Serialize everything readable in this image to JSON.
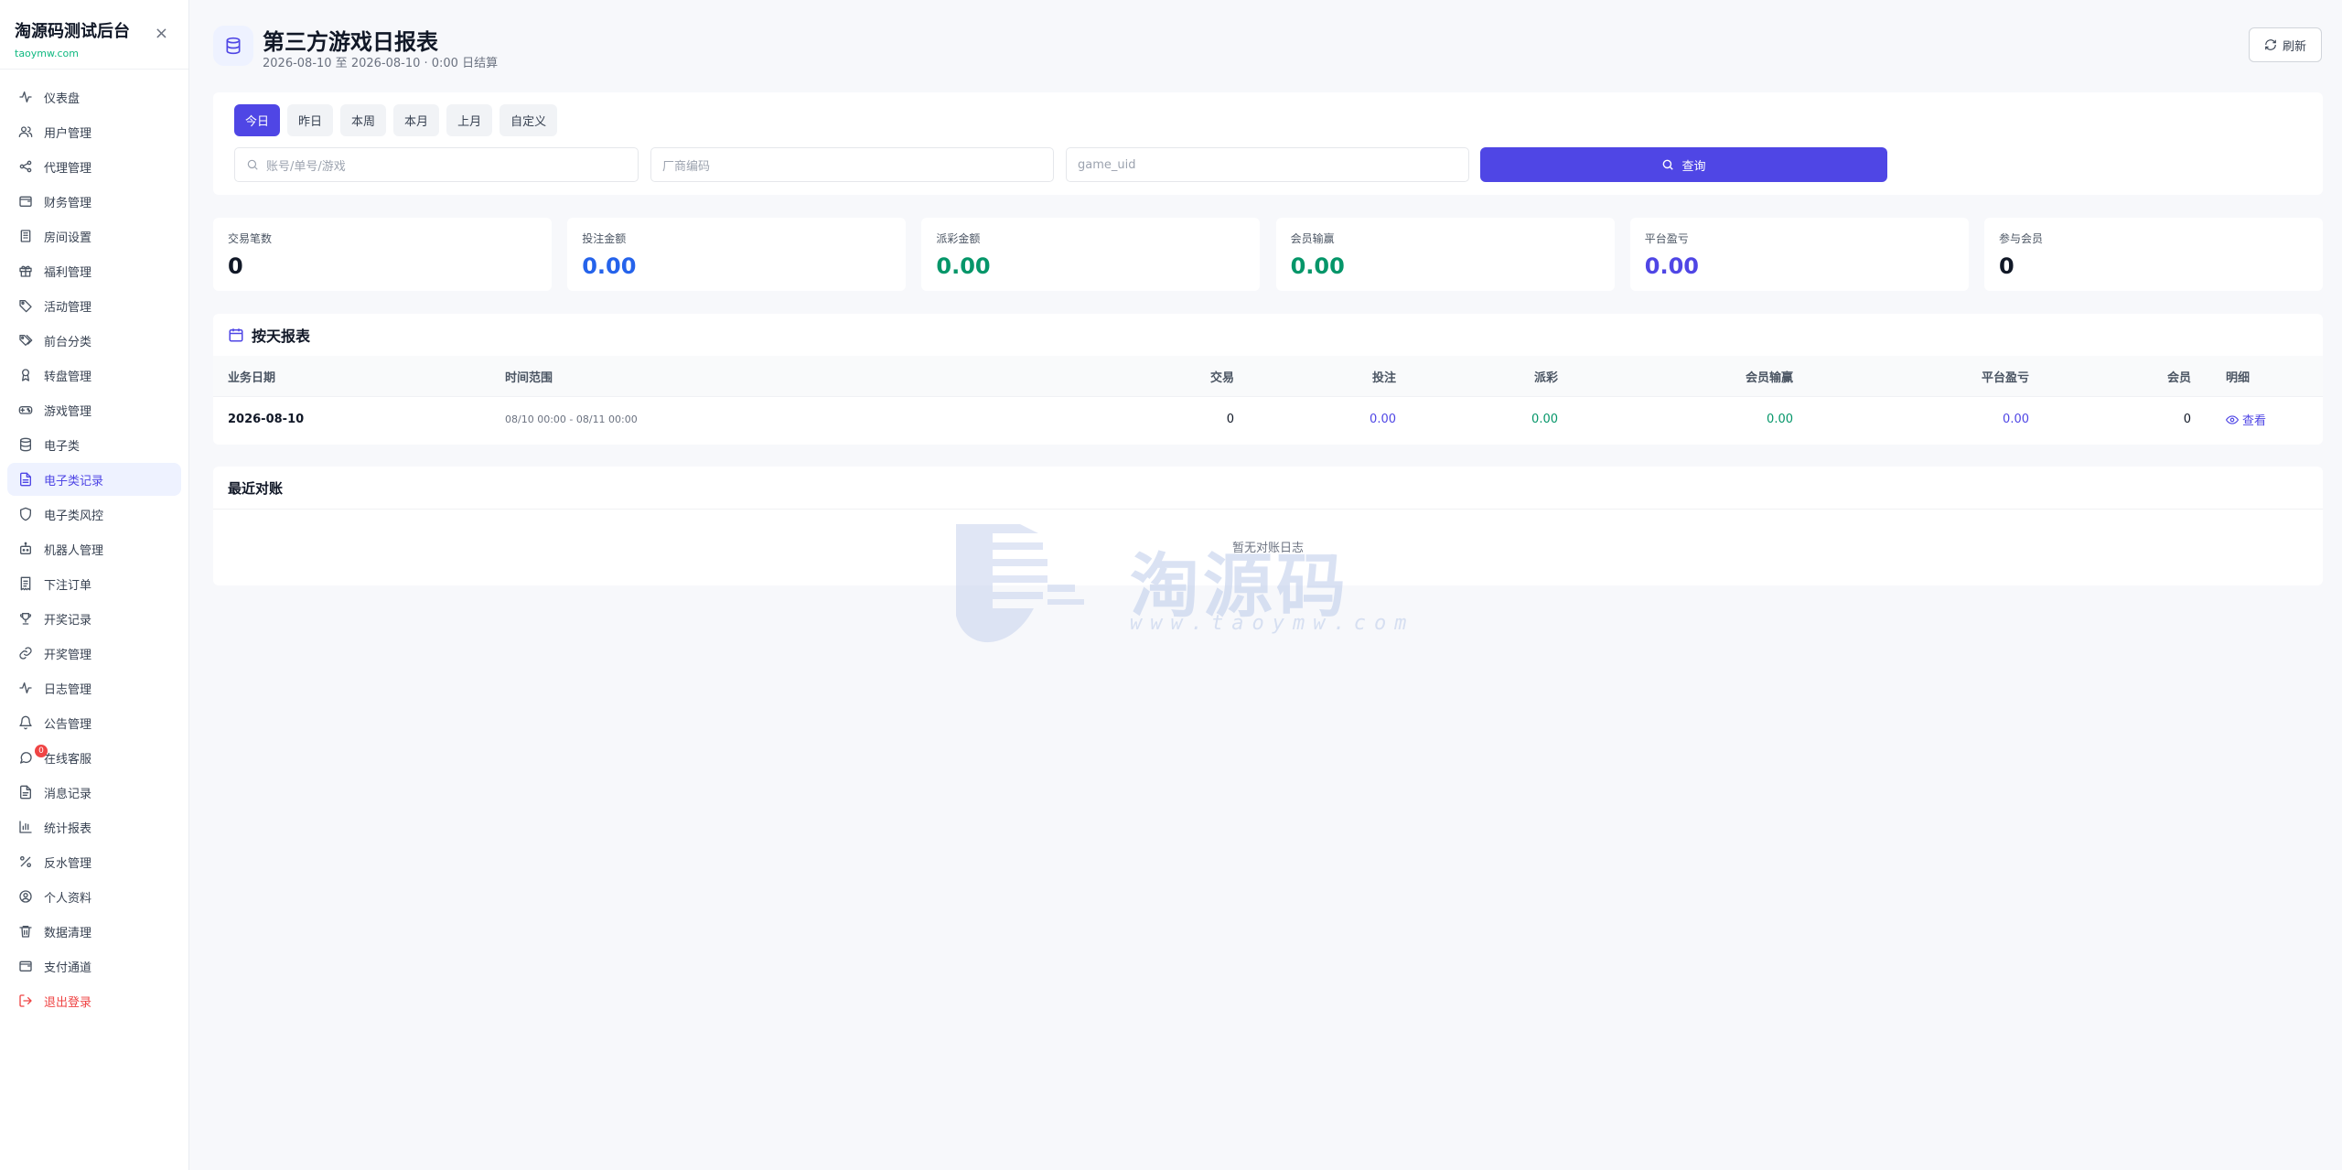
{
  "sidebar": {
    "brand_title": "淘源码测试后台",
    "brand_sub": "taoymw.com",
    "items": [
      {
        "label": "仪表盘",
        "icon": "activity-icon"
      },
      {
        "label": "用户管理",
        "icon": "users-icon"
      },
      {
        "label": "代理管理",
        "icon": "share-icon"
      },
      {
        "label": "财务管理",
        "icon": "wallet-icon"
      },
      {
        "label": "房间设置",
        "icon": "building-icon"
      },
      {
        "label": "福利管理",
        "icon": "gift-icon"
      },
      {
        "label": "活动管理",
        "icon": "tag-icon"
      },
      {
        "label": "前台分类",
        "icon": "tags-icon"
      },
      {
        "label": "转盘管理",
        "icon": "award-icon"
      },
      {
        "label": "游戏管理",
        "icon": "gamepad-icon"
      },
      {
        "label": "电子类",
        "icon": "database-icon"
      },
      {
        "label": "电子类记录",
        "icon": "file-text-icon",
        "active": true
      },
      {
        "label": "电子类风控",
        "icon": "shield-icon"
      },
      {
        "label": "机器人管理",
        "icon": "bot-icon"
      },
      {
        "label": "下注订单",
        "icon": "receipt-icon"
      },
      {
        "label": "开奖记录",
        "icon": "trophy-icon"
      },
      {
        "label": "开奖管理",
        "icon": "link-icon"
      },
      {
        "label": "日志管理",
        "icon": "pulse-icon"
      },
      {
        "label": "公告管理",
        "icon": "bell-icon"
      },
      {
        "label": "在线客服",
        "icon": "message-icon",
        "badge": "0"
      },
      {
        "label": "消息记录",
        "icon": "document-icon"
      },
      {
        "label": "统计报表",
        "icon": "bar-chart-icon"
      },
      {
        "label": "反水管理",
        "icon": "percent-icon"
      },
      {
        "label": "个人资料",
        "icon": "user-circle-icon"
      },
      {
        "label": "数据清理",
        "icon": "trash-icon"
      },
      {
        "label": "支付通道",
        "icon": "card-icon"
      },
      {
        "label": "退出登录",
        "icon": "logout-icon",
        "danger": true
      }
    ]
  },
  "header": {
    "title": "第三方游戏日报表",
    "subtitle": "2026-08-10 至 2026-08-10 · 0:00 日结算",
    "refresh_label": "刷新"
  },
  "filters": {
    "tabs": [
      "今日",
      "昨日",
      "本周",
      "本月",
      "上月",
      "自定义"
    ],
    "active_tab": "今日",
    "account_placeholder": "账号/单号/游戏",
    "vendor_placeholder": "厂商编码",
    "uid_placeholder": "game_uid",
    "query_label": "查询"
  },
  "stats": [
    {
      "label": "交易笔数",
      "value": "0",
      "tone": ""
    },
    {
      "label": "投注金额",
      "value": "0.00",
      "tone": "blue"
    },
    {
      "label": "派彩金额",
      "value": "0.00",
      "tone": "green"
    },
    {
      "label": "会员输赢",
      "value": "0.00",
      "tone": "green"
    },
    {
      "label": "平台盈亏",
      "value": "0.00",
      "tone": "purple"
    },
    {
      "label": "参与会员",
      "value": "0",
      "tone": ""
    }
  ],
  "daily": {
    "title": "按天报表",
    "columns": [
      "业务日期",
      "时间范围",
      "交易",
      "投注",
      "派彩",
      "会员输赢",
      "平台盈亏",
      "会员",
      "明细"
    ],
    "rows": [
      {
        "date": "2026-08-10",
        "range": "08/10 00:00 - 08/11 00:00",
        "trades": "0",
        "bet": "0.00",
        "payout": "0.00",
        "member_win": "0.00",
        "platform": "0.00",
        "members": "0",
        "detail": "查看"
      }
    ]
  },
  "recon": {
    "title": "最近对账",
    "empty": "暂无对账日志"
  },
  "watermark": {
    "text": "淘源码",
    "url": "www.taoymw.com"
  }
}
